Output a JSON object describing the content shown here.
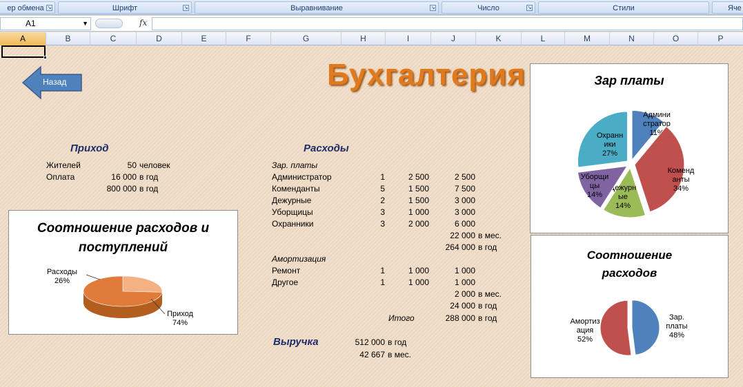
{
  "ribbon": {
    "groups": [
      {
        "label": "ер обмена"
      },
      {
        "label": "Шрифт"
      },
      {
        "label": "Выравнивание"
      },
      {
        "label": "Число"
      },
      {
        "label": "Стили"
      },
      {
        "label": "Яче"
      }
    ]
  },
  "formula_bar": {
    "name_box": "A1",
    "fx": "fx",
    "formula": ""
  },
  "columns": [
    "A",
    "B",
    "C",
    "D",
    "E",
    "F",
    "G",
    "H",
    "I",
    "J",
    "K",
    "L",
    "M",
    "N",
    "O",
    "P"
  ],
  "sheet": {
    "title": "Бухгалтерия",
    "back_button": "Назад",
    "income": {
      "header": "Приход",
      "rows": [
        {
          "label": "Жителей",
          "value": "50",
          "unit": "человек"
        },
        {
          "label": "Оплата",
          "value": "16 000",
          "unit": "в год"
        },
        {
          "label": "",
          "value": "800 000",
          "unit": "в год"
        }
      ]
    },
    "expenses": {
      "header": "Расходы",
      "salaries_label": "Зар. платы",
      "salaries": [
        {
          "name": "Администратор",
          "qty": "1",
          "price": "2 500",
          "total": "2 500"
        },
        {
          "name": "Коменданты",
          "qty": "5",
          "price": "1 500",
          "total": "7 500"
        },
        {
          "name": "Дежурные",
          "qty": "2",
          "price": "1 500",
          "total": "3 000"
        },
        {
          "name": "Уборщицы",
          "qty": "3",
          "price": "1 000",
          "total": "3 000"
        },
        {
          "name": "Охранники",
          "qty": "3",
          "price": "2 000",
          "total": "6 000"
        }
      ],
      "salaries_month": "22 000",
      "month_unit": "в мес.",
      "salaries_year": "264 000",
      "year_unit": "в год",
      "amort_label": "Амортизация",
      "amort": [
        {
          "name": "Ремонт",
          "qty": "1",
          "price": "1 000",
          "total": "1 000"
        },
        {
          "name": "Другое",
          "qty": "1",
          "price": "1 000",
          "total": "1 000"
        }
      ],
      "amort_month": "2 000",
      "amort_year": "24 000",
      "total_label": "Итого",
      "total_value": "288 000",
      "total_unit": "в год"
    },
    "revenue": {
      "header": "Выручка",
      "year_value": "512 000",
      "year_unit": "в год",
      "month_value": "42 667",
      "month_unit": "в мес."
    }
  },
  "chart_data": [
    {
      "type": "pie",
      "title": "Зар платы",
      "labels": [
        "Админи стратор",
        "Коменд анты",
        "Дежурн ые",
        "Уборщи цы",
        "Охранн ики"
      ],
      "values": [
        11,
        34,
        14,
        14,
        27
      ],
      "value_labels": [
        "11%",
        "34%",
        "14%",
        "14%",
        "27%"
      ],
      "colors": [
        "#4f81bd",
        "#c0504d",
        "#9bbb59",
        "#8064a2",
        "#4bacc6"
      ]
    },
    {
      "type": "pie",
      "title": "Соотношение расходов",
      "labels": [
        "Зар. платы",
        "Амортиз ация"
      ],
      "values": [
        48,
        52
      ],
      "value_labels": [
        "48%",
        "52%"
      ],
      "colors": [
        "#4f81bd",
        "#c0504d"
      ]
    },
    {
      "type": "pie",
      "title": "Соотношение расходов и поступлений",
      "labels": [
        "Расходы",
        "Приход"
      ],
      "values": [
        26,
        74
      ],
      "value_labels": [
        "26%",
        "74%"
      ],
      "colors": [
        "#f4b183",
        "#e07b39"
      ]
    }
  ]
}
